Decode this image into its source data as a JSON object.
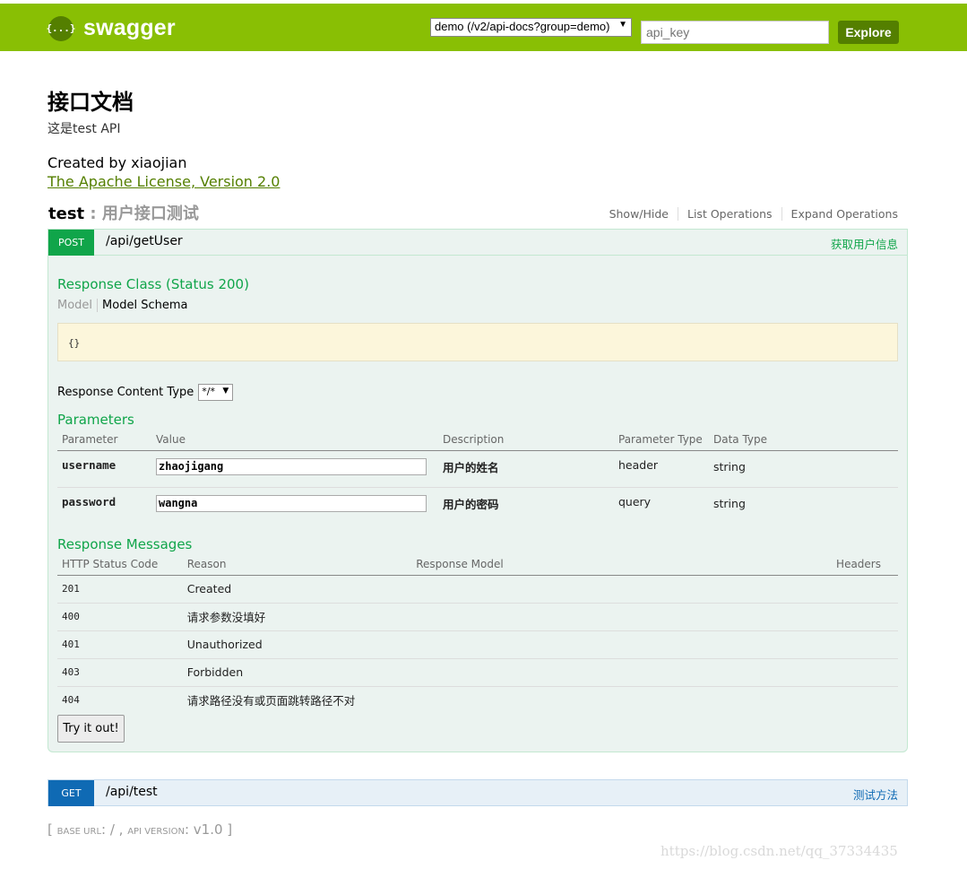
{
  "header": {
    "logo_icon": "{...}",
    "logo_text": "swagger",
    "url_select": "demo (/v2/api-docs?group=demo)",
    "api_key_placeholder": "api_key",
    "explore_label": "Explore",
    "bar_color": "#89bf04"
  },
  "info": {
    "title": "接口文档",
    "description": "这是test API",
    "created_by": "Created by xiaojian",
    "license": "The Apache License, Version 2.0"
  },
  "resource": {
    "name": "test",
    "separator": " : ",
    "description": "用户接口测试",
    "links": [
      "Show/Hide",
      "List Operations",
      "Expand Operations"
    ]
  },
  "post_op": {
    "method": "POST",
    "path": "/api/getUser",
    "summary": "获取用户信息",
    "response_class_title": "Response Class (Status 200)",
    "model_tab": "Model",
    "model_schema_tab": "Model Schema",
    "schema": "{}",
    "content_type_label": "Response Content Type",
    "content_type_value": "*/*",
    "parameters_title": "Parameters",
    "param_headers": [
      "Parameter",
      "Value",
      "Description",
      "Parameter Type",
      "Data Type"
    ],
    "params": [
      {
        "name": "username",
        "value": "zhaojigang",
        "description": "用户的姓名",
        "param_type": "header",
        "data_type": "string"
      },
      {
        "name": "password",
        "value": "wangna",
        "description": "用户的密码",
        "param_type": "query",
        "data_type": "string"
      }
    ],
    "response_messages_title": "Response Messages",
    "resp_headers": [
      "HTTP Status Code",
      "Reason",
      "Response Model",
      "Headers"
    ],
    "responses": [
      {
        "code": "201",
        "reason": "Created"
      },
      {
        "code": "400",
        "reason": "请求参数没填好"
      },
      {
        "code": "401",
        "reason": "Unauthorized"
      },
      {
        "code": "403",
        "reason": "Forbidden"
      },
      {
        "code": "404",
        "reason": "请求路径没有或页面跳转路径不对"
      }
    ],
    "try_label": "Try it out!",
    "method_color": "#10a54a"
  },
  "get_op": {
    "method": "GET",
    "path": "/api/test",
    "summary": "测试方法",
    "method_color": "#0f6ab4"
  },
  "footer": {
    "open": "[ ",
    "base_url_label": "base url",
    "base_url_value": ": / , ",
    "api_version_label": "api version",
    "api_version_value": ": v1.0",
    "close": " ]",
    "watermark": "https://blog.csdn.net/qq_37334435"
  }
}
